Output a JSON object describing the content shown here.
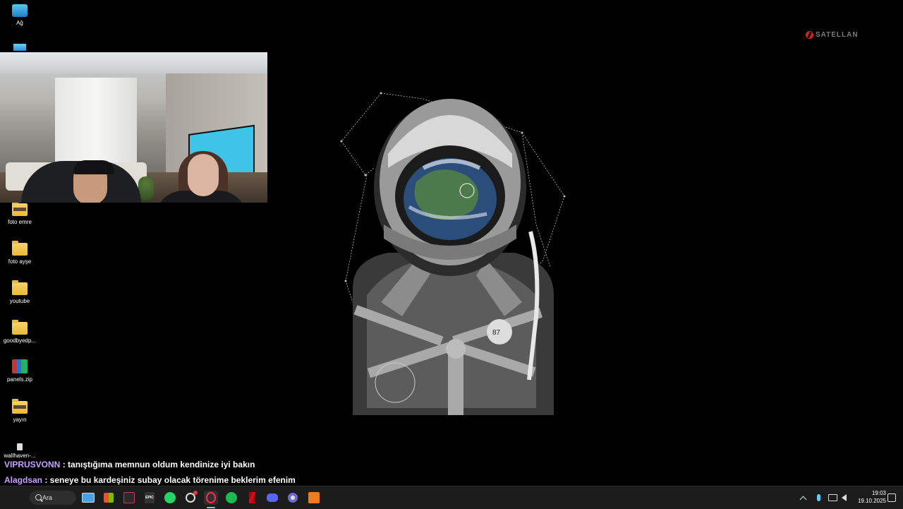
{
  "desktop": {
    "icons": [
      {
        "label": "Ağ",
        "icon": "network-icon"
      },
      {
        "label": "foto emre",
        "icon": "folder-icon"
      },
      {
        "label": "foto ayşe",
        "icon": "folder-icon"
      },
      {
        "label": "youtube",
        "icon": "folder-icon"
      },
      {
        "label": "goodbyedp...",
        "icon": "folder-icon"
      },
      {
        "label": "panels.zip",
        "icon": "zip-archive-icon"
      },
      {
        "label": "yayın",
        "icon": "folder-icon"
      },
      {
        "label": "wallhaven-...",
        "icon": "image-file-icon"
      }
    ]
  },
  "logo": {
    "text": "SATELLAN"
  },
  "chat": [
    {
      "user": "VIPRUSVONN",
      "message": " : tanıştığıma memnun oldum kendinize iyi bakın"
    },
    {
      "user": "Alagdsan",
      "message": " : seneye bu kardeşiniz subay olacak törenime beklerim efenim"
    }
  ],
  "taskbar": {
    "search_label": "Ara",
    "apps": [
      "mail-icon",
      "store-icon",
      "app-icon",
      "epic-games-icon",
      "whatsapp-icon",
      "steam-icon",
      "opera-gx-icon",
      "spotify-icon",
      "netflix-icon",
      "discord-icon",
      "browser-icon",
      "orange-app-icon"
    ],
    "epic_label": "EPIC",
    "clock": {
      "time": "19:03",
      "date": "19.10.2025"
    }
  },
  "colors": {
    "chat_user": "#c6a2ff",
    "taskbar": "#1c1c1c",
    "accent": "#60cdff"
  }
}
